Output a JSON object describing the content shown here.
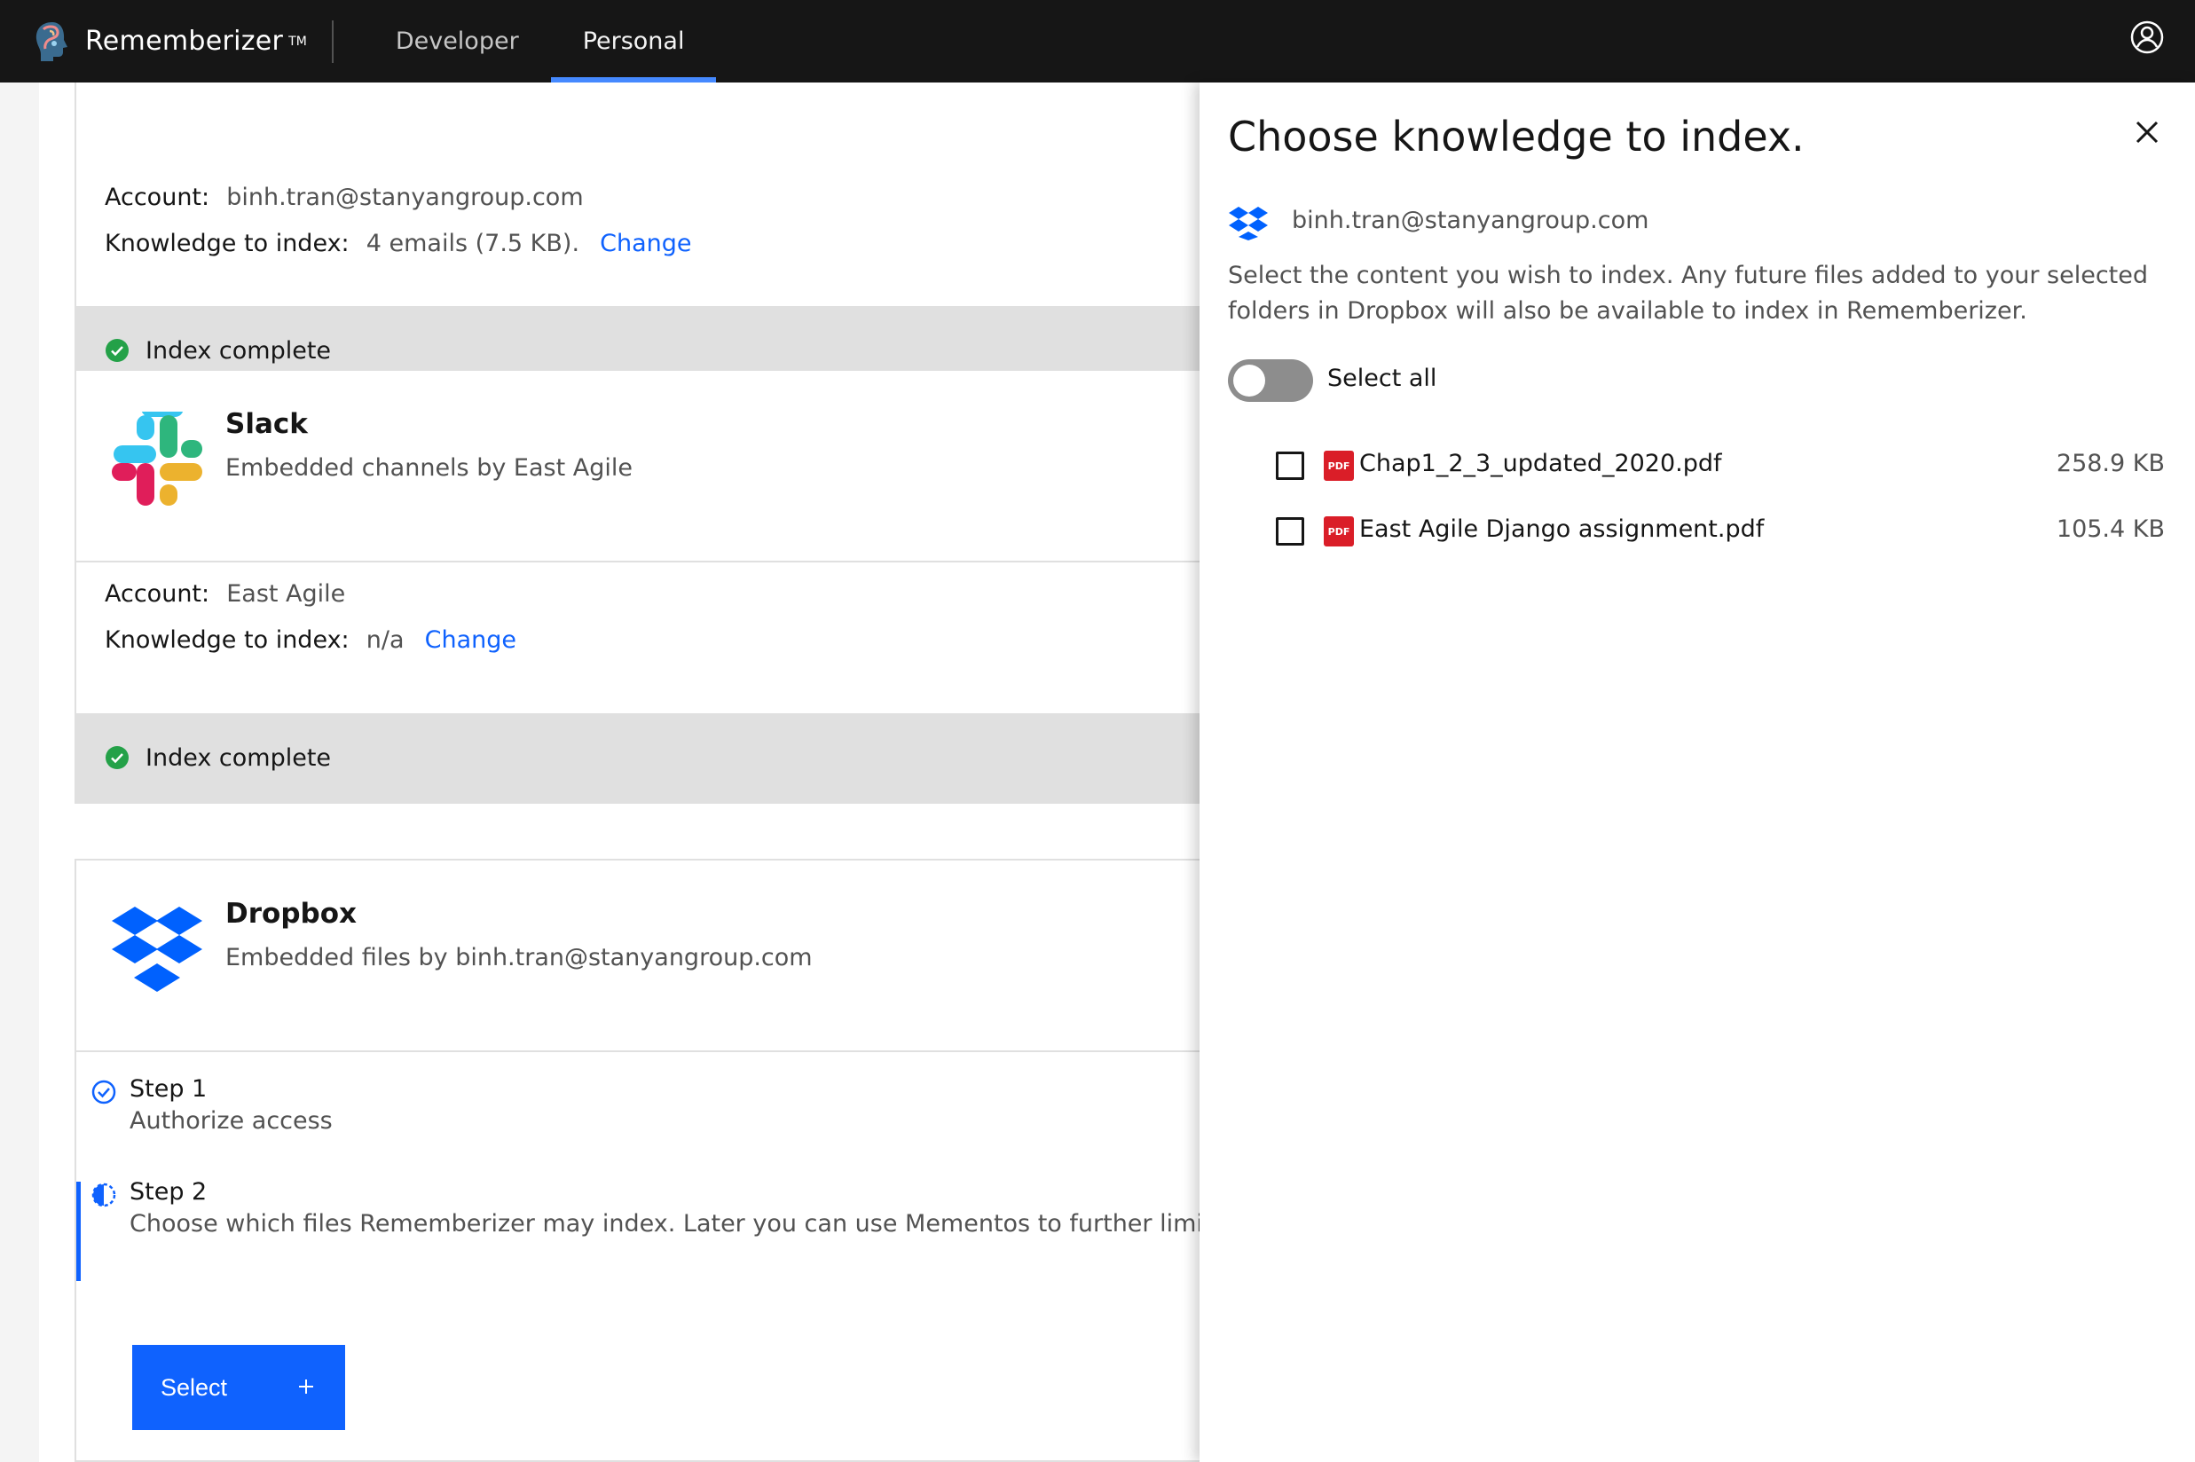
{
  "topbar": {
    "brand": "Rememberizer",
    "brand_tm": "TM",
    "tabs": [
      {
        "label": "Developer",
        "active": false
      },
      {
        "label": "Personal",
        "active": true
      }
    ],
    "icons": {
      "logo": "rememberizer-logo-icon",
      "user": "user-profile-icon"
    }
  },
  "gmail_card": {
    "account_label": "Account:",
    "account_value": "binh.tran@stanyangroup.com",
    "knowledge_label": "Knowledge to index:",
    "knowledge_value": "4 emails (7.5 KB).",
    "change_link": "Change",
    "status": "Index complete"
  },
  "slack_card": {
    "title": "Slack",
    "description": "Embedded channels by East Agile",
    "account_label": "Account:",
    "account_value": "East Agile",
    "knowledge_label": "Knowledge to index:",
    "knowledge_value": "n/a",
    "change_link": "Change",
    "status": "Index complete"
  },
  "dropbox_card": {
    "title": "Dropbox",
    "description": "Embedded files by binh.tran@stanyangroup.com",
    "steps": [
      {
        "title": "Step 1",
        "description": "Authorize access",
        "state": "complete"
      },
      {
        "title": "Step 2",
        "description": "Choose which files Rememberizer may index. Later you can use Mementos to further limit what",
        "state": "in-progress"
      }
    ],
    "select_button": "Select",
    "select_icon": "plus"
  },
  "panel": {
    "title": "Choose knowledge to index.",
    "account": "binh.tran@stanyangroup.com",
    "description": "Select the content you wish to index. Any future files added to your selected folders in Dropbox will also be available to index in Rememberizer.",
    "select_all_label": "Select all",
    "select_all_on": false,
    "pdf_badge": "PDF",
    "files": [
      {
        "name": "Chap1_2_3_updated_2020.pdf",
        "size": "258.9 KB",
        "checked": false
      },
      {
        "name": "East Agile Django assignment.pdf",
        "size": "105.4 KB",
        "checked": false
      }
    ]
  },
  "colors": {
    "topbar": "#161616",
    "accent": "#0f62fe",
    "success": "#24a148",
    "dropbox": "#0061fe",
    "pdf": "#da1e28"
  }
}
